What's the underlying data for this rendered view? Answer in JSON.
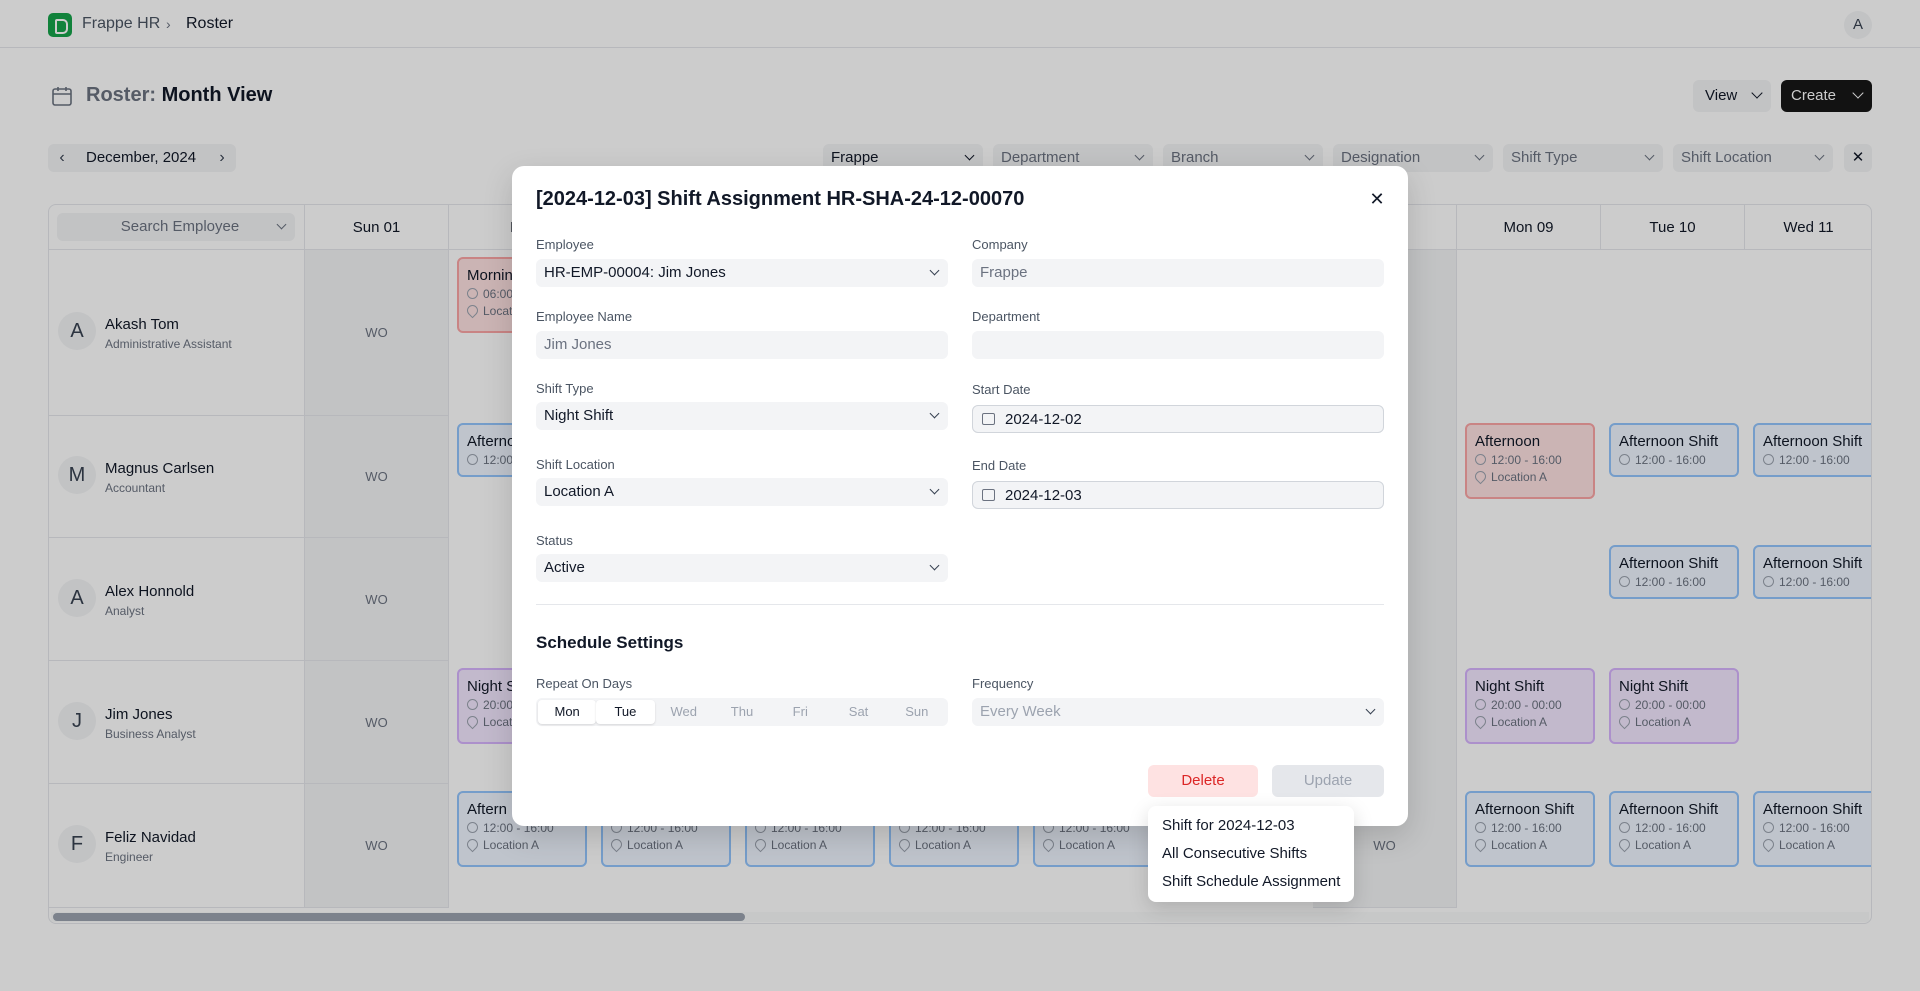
{
  "nav": {
    "app_name": "Frappe HR",
    "separator": "›",
    "current": "Roster",
    "user_initial": "A"
  },
  "header": {
    "title_prefix": "Roster:",
    "title": "Month View",
    "view_label": "View",
    "create_label": "Create"
  },
  "month_nav": {
    "label": "December, 2024",
    "prev": "‹",
    "next": "›"
  },
  "filters": [
    {
      "label": "Frappe",
      "selected": true
    },
    {
      "label": "Department",
      "selected": false
    },
    {
      "label": "Branch",
      "selected": false
    },
    {
      "label": "Designation",
      "selected": false
    },
    {
      "label": "Shift Type",
      "selected": false
    },
    {
      "label": "Shift Location",
      "selected": false
    }
  ],
  "filters_clear": "✕",
  "grid": {
    "search_placeholder": "Search Employee",
    "visible_day_headers": {
      "sun01": "Sun 01",
      "mon02_partial": "Mo",
      "mon09": "Mon 09",
      "tue10": "Tue 10",
      "wed11": "Wed 11"
    },
    "weekly_off_label": "WO",
    "employees": [
      {
        "initial": "A",
        "name": "Akash Tom",
        "role": "Administrative Assistant"
      },
      {
        "initial": "M",
        "name": "Magnus Carlsen",
        "role": "Accountant"
      },
      {
        "initial": "A",
        "name": "Alex Honnold",
        "role": "Analyst"
      },
      {
        "initial": "J",
        "name": "Jim Jones",
        "role": "Business Analyst"
      },
      {
        "initial": "F",
        "name": "Feliz Navidad",
        "role": "Engineer"
      }
    ],
    "shifts": {
      "akash_mon02": {
        "title": "Mornin",
        "time": "06:00",
        "location": "Locatio"
      },
      "magnus_mon02": {
        "title": "Afterno",
        "time": "12:00"
      },
      "magnus_mon09": {
        "title": "Afternoon",
        "time": "12:00 - 16:00",
        "location": "Location A"
      },
      "magnus_tue10": {
        "title": "Afternoon Shift",
        "time": "12:00 - 16:00"
      },
      "magnus_wed11": {
        "title": "Afternoon Shift",
        "time": "12:00 - 16:00"
      },
      "alex_tue10": {
        "title": "Afternoon Shift",
        "time": "12:00 - 16:00"
      },
      "alex_wed11": {
        "title": "Afternoon Shift",
        "time": "12:00 - 16:00"
      },
      "jim_mon02": {
        "title": "Night S",
        "time": "20:00",
        "location": "Locatio"
      },
      "jim_mon09": {
        "title": "Night Shift",
        "time": "20:00 - 00:00",
        "location": "Location A"
      },
      "jim_tue10": {
        "title": "Night Shift",
        "time": "20:00 - 00:00",
        "location": "Location A"
      },
      "feliz_mon02": {
        "title": "Aftern",
        "time": "12:00 - 16:00",
        "location": "Location A"
      },
      "feliz_tue03": {
        "time": "12:00 - 16:00",
        "location": "Location A"
      },
      "feliz_wed04": {
        "time": "12:00 - 16:00",
        "location": "Location A"
      },
      "feliz_thu05": {
        "time": "12:00 - 16:00",
        "location": "Location A"
      },
      "feliz_fri06": {
        "time": "12:00 - 16:00",
        "location": "Location A"
      },
      "feliz_mon09": {
        "title": "Afternoon Shift",
        "time": "12:00 - 16:00",
        "location": "Location A"
      },
      "feliz_tue10": {
        "title": "Afternoon Shift",
        "time": "12:00 - 16:00",
        "location": "Location A"
      },
      "feliz_wed11": {
        "title": "Afternoon Shift",
        "time": "12:00 - 16:00",
        "location": "Location A"
      }
    }
  },
  "dialog": {
    "title": "[2024-12-03] Shift Assignment HR-SHA-24-12-00070",
    "close": "✕",
    "fields": {
      "employee": {
        "label": "Employee",
        "value": "HR-EMP-00004: Jim Jones"
      },
      "company": {
        "label": "Company",
        "value": "Frappe"
      },
      "employee_name": {
        "label": "Employee Name",
        "value": "Jim  Jones"
      },
      "department": {
        "label": "Department",
        "value": ""
      },
      "shift_type": {
        "label": "Shift Type",
        "value": "Night Shift"
      },
      "start_date": {
        "label": "Start Date",
        "value": "2024-12-02"
      },
      "shift_location": {
        "label": "Shift Location",
        "value": "Location A"
      },
      "end_date": {
        "label": "End Date",
        "value": "2024-12-03"
      },
      "status": {
        "label": "Status",
        "value": "Active"
      }
    },
    "schedule": {
      "title": "Schedule Settings",
      "repeat_label": "Repeat On Days",
      "days": [
        {
          "label": "Mon",
          "on": true
        },
        {
          "label": "Tue",
          "on": true
        },
        {
          "label": "Wed",
          "on": false
        },
        {
          "label": "Thu",
          "on": false
        },
        {
          "label": "Fri",
          "on": false
        },
        {
          "label": "Sat",
          "on": false
        },
        {
          "label": "Sun",
          "on": false
        }
      ],
      "frequency_label": "Frequency",
      "frequency_value": "Every Week"
    },
    "delete_label": "Delete",
    "update_label": "Update"
  },
  "delete_menu": {
    "items": [
      "Shift for 2024-12-03",
      "All Consecutive Shifts",
      "Shift Schedule Assignment"
    ]
  }
}
